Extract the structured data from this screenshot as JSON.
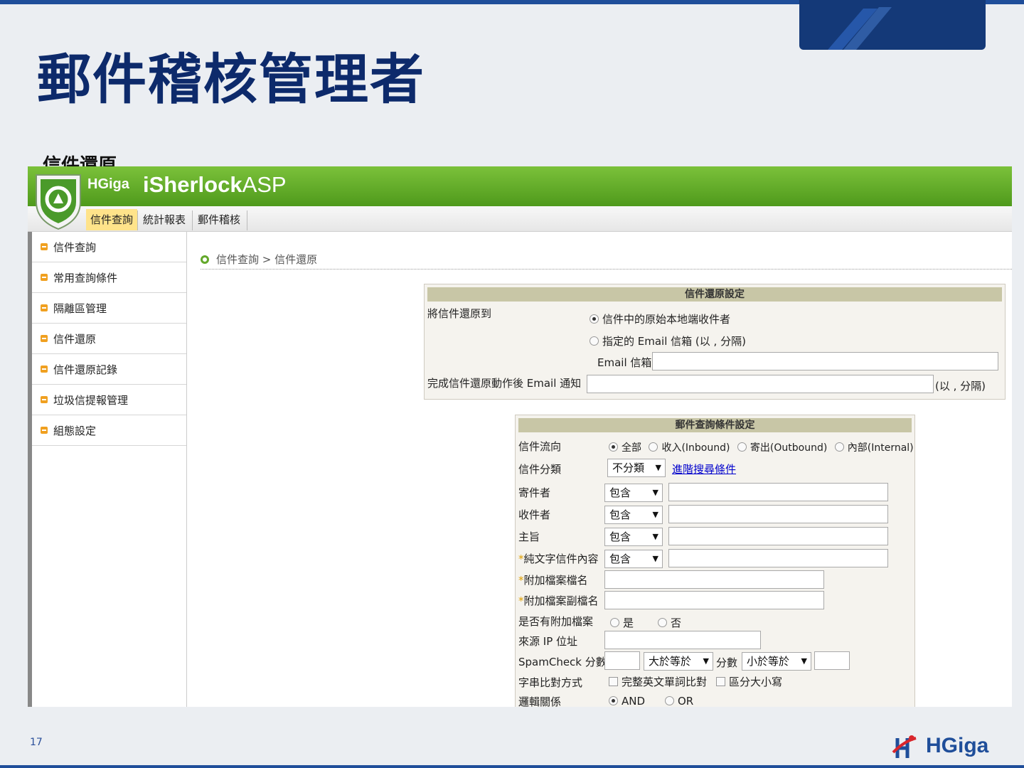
{
  "slide": {
    "title": "郵件稽核管理者",
    "subtitle": "信件還原",
    "page_number": "17",
    "brand": "HGiga"
  },
  "app": {
    "brand_prefix": "HGiga",
    "brand_bold": "iSherlock",
    "brand_suffix": "ASP",
    "tabs": [
      "信件查詢",
      "統計報表",
      "郵件稽核"
    ],
    "active_tab": "信件查詢",
    "sidebar": [
      "信件查詢",
      "常用查詢條件",
      "隔離區管理",
      "信件還原",
      "信件還原記錄",
      "垃圾信提報管理",
      "組態設定"
    ],
    "breadcrumb": "信件查詢 > 信件還原"
  },
  "restore_panel": {
    "header": "信件還原設定",
    "restore_to_label": "將信件還原到",
    "option_original": "信件中的原始本地端收件者",
    "option_specified": "指定的 Email 信箱 (以 , 分隔)",
    "email_label": "Email 信箱",
    "notify_label": "完成信件還原動作後 Email 通知",
    "notify_suffix": "(以 , 分隔)"
  },
  "query_panel": {
    "header": "郵件查詢條件設定",
    "direction_label": "信件流向",
    "directions": [
      "全部",
      "收入(Inbound)",
      "寄出(Outbound)",
      "內部(Internal)"
    ],
    "category_label": "信件分類",
    "category_value": "不分類",
    "advanced_link": "進階搜尋條件",
    "sender_label": "寄件者",
    "recipient_label": "收件者",
    "subject_label": "主旨",
    "plaintext_label": "純文字信件內容",
    "contains": "包含",
    "attach_name_label": "附加檔案檔名",
    "attach_ext_label": "附加檔案副檔名",
    "has_attach_label": "是否有附加檔案",
    "yes": "是",
    "no": "否",
    "source_ip_label": "來源 IP 位址",
    "spam_label": "SpamCheck 分數",
    "gte": "大於等於",
    "score": "分數",
    "lte": "小於等於",
    "match_label": "字串比對方式",
    "whole_word": "完整英文單詞比對",
    "case_sensitive": "區分大小寫",
    "logic_label": "邏輯關係",
    "logic_and": "AND",
    "logic_or": "OR"
  },
  "colors": {
    "title": "#0d2a6b",
    "accent_blue": "#1f4e9a",
    "header_green": "#5aa526",
    "active_tab": "#ffe38a"
  }
}
